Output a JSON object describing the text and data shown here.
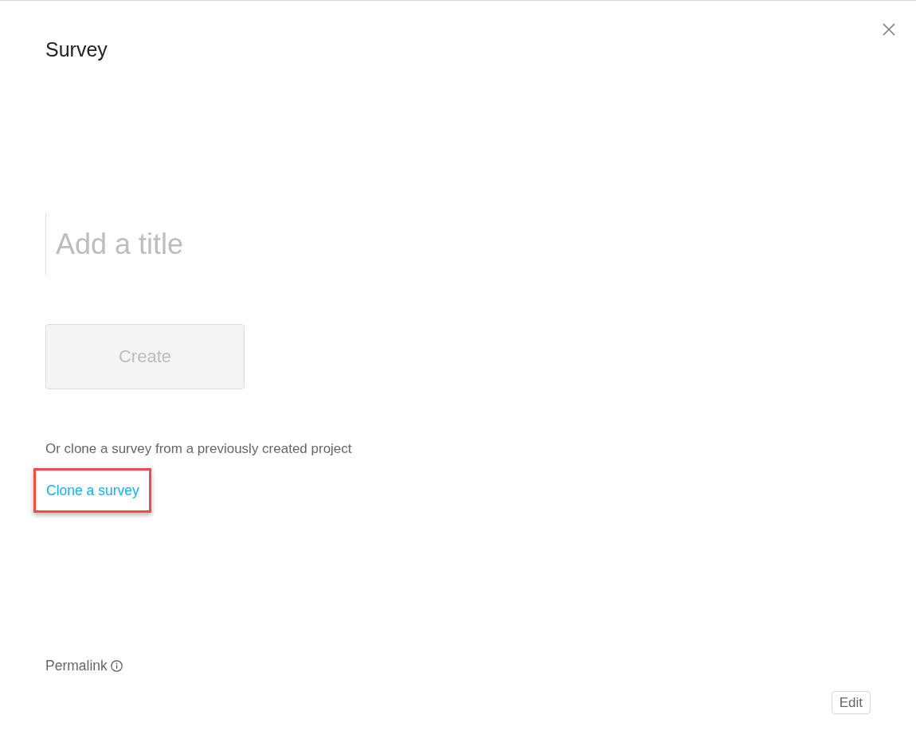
{
  "dialog": {
    "title": "Survey"
  },
  "title_field": {
    "placeholder": "Add a title"
  },
  "create_button": {
    "label": "Create",
    "disabled": true
  },
  "clone_prompt": "Or clone a survey from a previously created project",
  "clone_link": {
    "label": "Clone a survey",
    "highlighted": true
  },
  "permalink": {
    "label": "Permalink"
  },
  "edit_button": {
    "label": "Edit"
  }
}
